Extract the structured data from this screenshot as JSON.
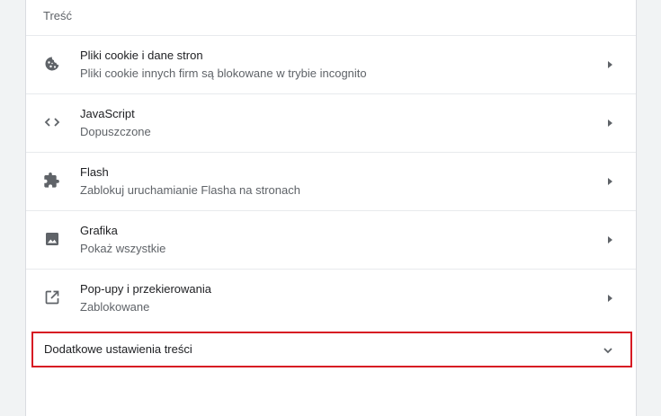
{
  "section": {
    "title": "Treść"
  },
  "rows": [
    {
      "label": "Pliki cookie i dane stron",
      "sub": "Pliki cookie innych firm są blokowane w trybie incognito",
      "icon": "cookie-icon"
    },
    {
      "label": "JavaScript",
      "sub": "Dopuszczone",
      "icon": "code-icon"
    },
    {
      "label": "Flash",
      "sub": "Zablokuj uruchamianie Flasha na stronach",
      "icon": "puzzle-icon"
    },
    {
      "label": "Grafika",
      "sub": "Pokaż wszystkie",
      "icon": "image-icon"
    },
    {
      "label": "Pop-upy i przekierowania",
      "sub": "Zablokowane",
      "icon": "open-in-new-icon"
    }
  ],
  "advanced": {
    "label": "Dodatkowe ustawienia treści",
    "icon": "chevron-down-icon",
    "highlight_color": "#d71a23"
  }
}
